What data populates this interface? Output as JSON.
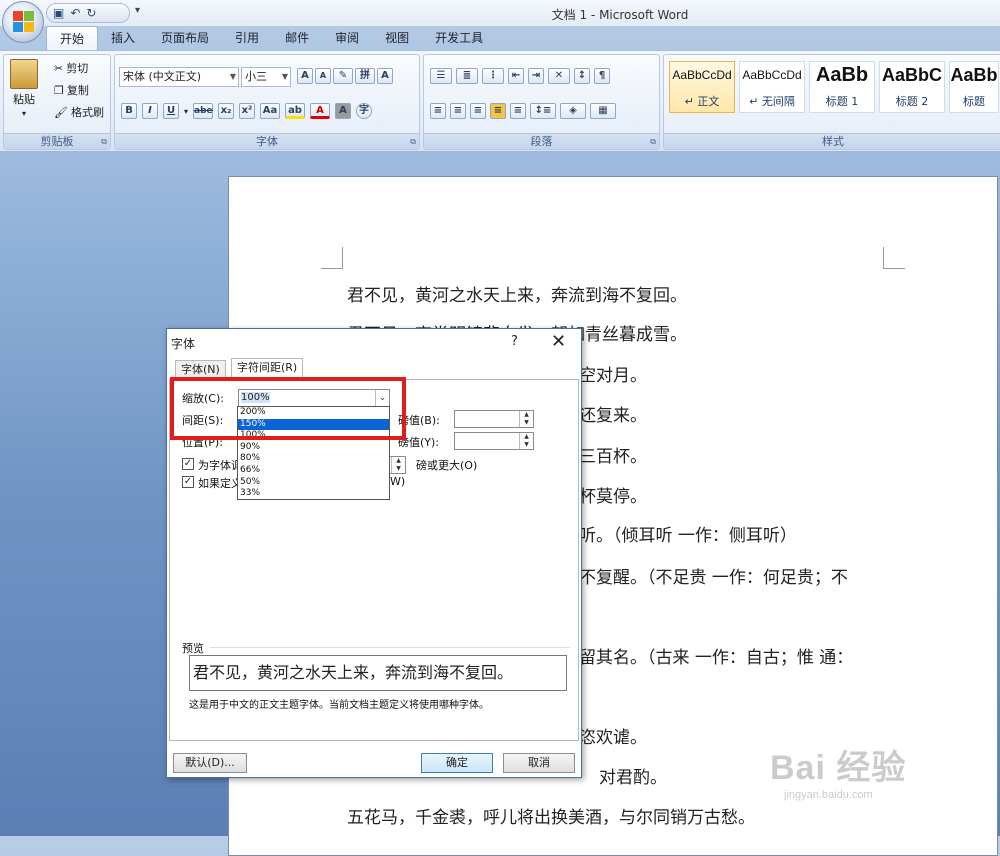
{
  "window": {
    "title": "文档 1 - Microsoft Word",
    "qat_icons": [
      "save-icon",
      "undo-icon",
      "redo-icon"
    ]
  },
  "ribbon": {
    "tabs": [
      "开始",
      "插入",
      "页面布局",
      "引用",
      "邮件",
      "审阅",
      "视图",
      "开发工具"
    ],
    "active_tab": "开始",
    "clipboard": {
      "label": "剪贴板",
      "paste": "粘贴",
      "cut": "剪切",
      "copy": "复制",
      "format_painter": "格式刷"
    },
    "font": {
      "label": "字体",
      "font_name": "宋体 (中文正文)",
      "font_size": "小三",
      "bold": "B",
      "italic": "I",
      "underline": "U",
      "strike": "abe",
      "sub": "x₂",
      "sup": "x²",
      "case": "Aa",
      "highlight": "ab",
      "color": "A",
      "char_shade": "A",
      "enclose": "字",
      "grow": "A",
      "shrink": "A",
      "phonetic": "拼",
      "border_char": "A"
    },
    "paragraph": {
      "label": "段落"
    },
    "styles": {
      "label": "样式",
      "items": [
        {
          "sample": "AaBbCcDd",
          "name": "↵ 正文"
        },
        {
          "sample": "AaBbCcDd",
          "name": "↵ 无间隔"
        },
        {
          "sample": "AaBb",
          "name": "标题 1"
        },
        {
          "sample": "AaBbC",
          "name": "标题 2"
        },
        {
          "sample": "AaBb",
          "name": "标题"
        }
      ]
    }
  },
  "document": {
    "lines": [
      "君不见，黄河之水天上来，奔流到海不复回。",
      "君不见，高堂明镜悲白发，朝如青丝暮成雪。",
      "空对月。",
      "还复来。",
      "三百杯。",
      "杯莫停。",
      "听。（倾耳听  一作：侧耳听）",
      "不复醒。（不足贵  一作：何足贵；不",
      "留其名。（古来  一作：自古；惟  通：",
      "恣欢谑。",
      "对君酌。",
      "五花马，千金裘，呼儿将出换美酒，与尔同销万古愁。"
    ]
  },
  "dialog": {
    "title": "字体",
    "help": "?",
    "close": "✕",
    "tabs": [
      "字体(N)",
      "字符间距(R)"
    ],
    "scale_label": "缩放(C):",
    "scale_value": "100%",
    "scale_options": [
      "200%",
      "150%",
      "100%",
      "90%",
      "80%",
      "66%",
      "50%",
      "33%"
    ],
    "scale_highlight": "150%",
    "spacing_label": "间距(S):",
    "position_label": "位置(P):",
    "pounds_b": "磅值(B):",
    "pounds_y": "磅值(Y):",
    "kerning_check": "为字体调",
    "kerning_suffix": "磅或更大(O)",
    "grid_check": "如果定义",
    "grid_suffix": "W)",
    "preview_label": "预览",
    "preview_text": "君不见，黄河之水天上来，奔流到海不复回。",
    "preview_note": "这是用于中文的正文主题字体。当前文档主题定义将使用哪种字体。",
    "default_button": "默认(D)...",
    "ok_button": "确定",
    "cancel_button": "取消"
  },
  "watermark": {
    "main": "Bai 经验",
    "sub": "jingyan.baidu.com"
  }
}
